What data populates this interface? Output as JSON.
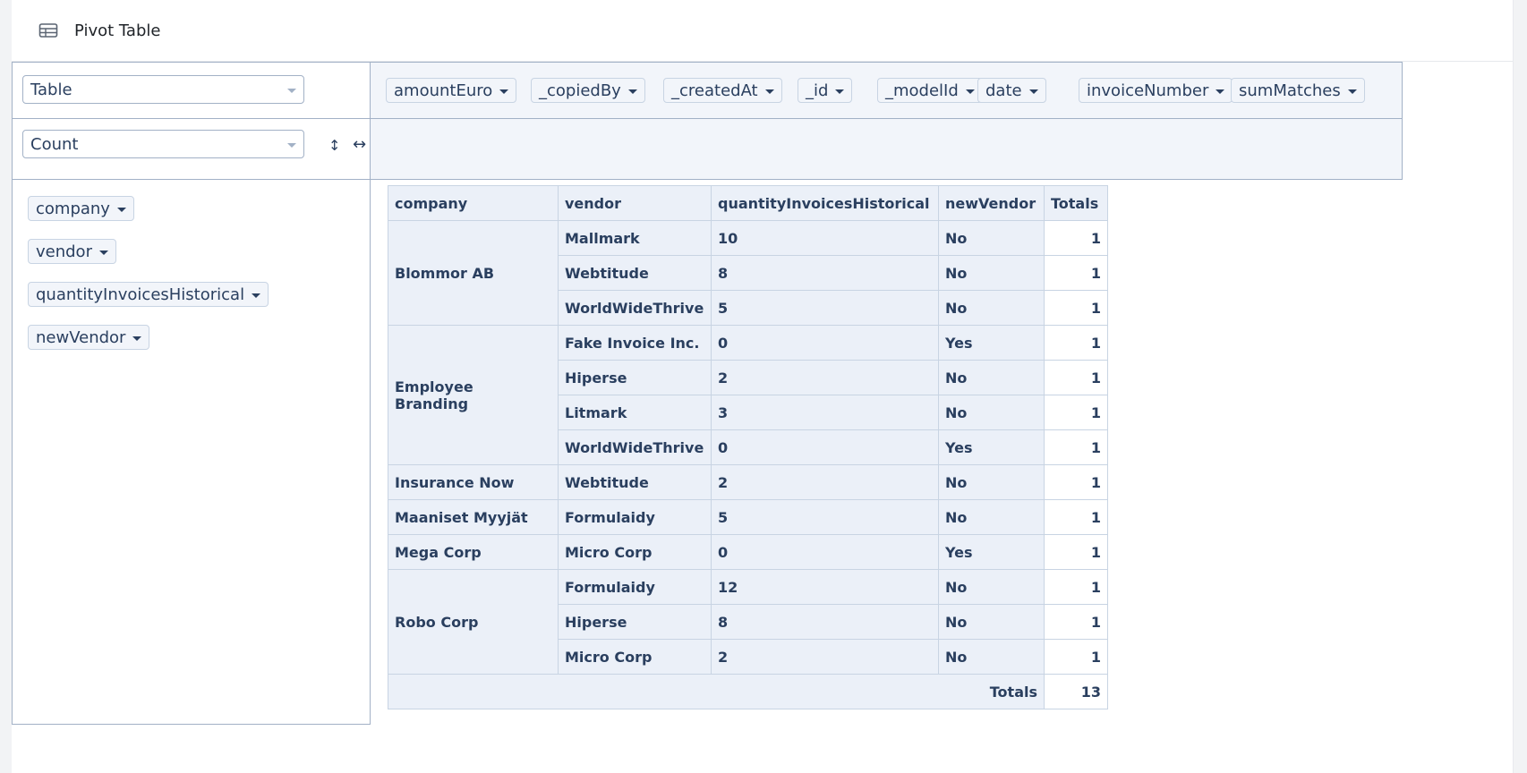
{
  "header": {
    "title": "Pivot Table",
    "icon": "table-icon"
  },
  "renderer": {
    "selected": "Table"
  },
  "aggregator": {
    "selected": "Count"
  },
  "controls": {
    "sort_icon": "↕",
    "flip_icon": "↔"
  },
  "unused_attrs": [
    "amountEuro",
    "_copiedBy",
    "_createdAt",
    "_id",
    "_modelId",
    "date",
    "invoiceNumber",
    "sumMatches"
  ],
  "row_attrs": [
    "company",
    "vendor",
    "quantityInvoicesHistorical",
    "newVendor"
  ],
  "table": {
    "headers": [
      "company",
      "vendor",
      "quantityInvoicesHistorical",
      "newVendor",
      "Totals"
    ],
    "groups": [
      {
        "company": "Blommor AB",
        "rows": [
          {
            "vendor": "Mallmark",
            "qty": "10",
            "newVendor": "No",
            "count": "1"
          },
          {
            "vendor": "Webtitude",
            "qty": "8",
            "newVendor": "No",
            "count": "1"
          },
          {
            "vendor": "WorldWideThrive",
            "qty": "5",
            "newVendor": "No",
            "count": "1"
          }
        ]
      },
      {
        "company": "Employee Branding",
        "rows": [
          {
            "vendor": "Fake Invoice Inc.",
            "qty": "0",
            "newVendor": "Yes",
            "count": "1"
          },
          {
            "vendor": "Hiperse",
            "qty": "2",
            "newVendor": "No",
            "count": "1"
          },
          {
            "vendor": "Litmark",
            "qty": "3",
            "newVendor": "No",
            "count": "1"
          },
          {
            "vendor": "WorldWideThrive",
            "qty": "0",
            "newVendor": "Yes",
            "count": "1"
          }
        ]
      },
      {
        "company": "Insurance Now",
        "rows": [
          {
            "vendor": "Webtitude",
            "qty": "2",
            "newVendor": "No",
            "count": "1"
          }
        ]
      },
      {
        "company": "Maaniset Myyjät",
        "rows": [
          {
            "vendor": "Formulaidy",
            "qty": "5",
            "newVendor": "No",
            "count": "1"
          }
        ]
      },
      {
        "company": "Mega Corp",
        "rows": [
          {
            "vendor": "Micro Corp",
            "qty": "0",
            "newVendor": "Yes",
            "count": "1"
          }
        ]
      },
      {
        "company": "Robo Corp",
        "rows": [
          {
            "vendor": "Formulaidy",
            "qty": "12",
            "newVendor": "No",
            "count": "1"
          },
          {
            "vendor": "Hiperse",
            "qty": "8",
            "newVendor": "No",
            "count": "1"
          },
          {
            "vendor": "Micro Corp",
            "qty": "2",
            "newVendor": "No",
            "count": "1"
          }
        ]
      }
    ],
    "totals_label": "Totals",
    "grand_total": "13"
  }
}
